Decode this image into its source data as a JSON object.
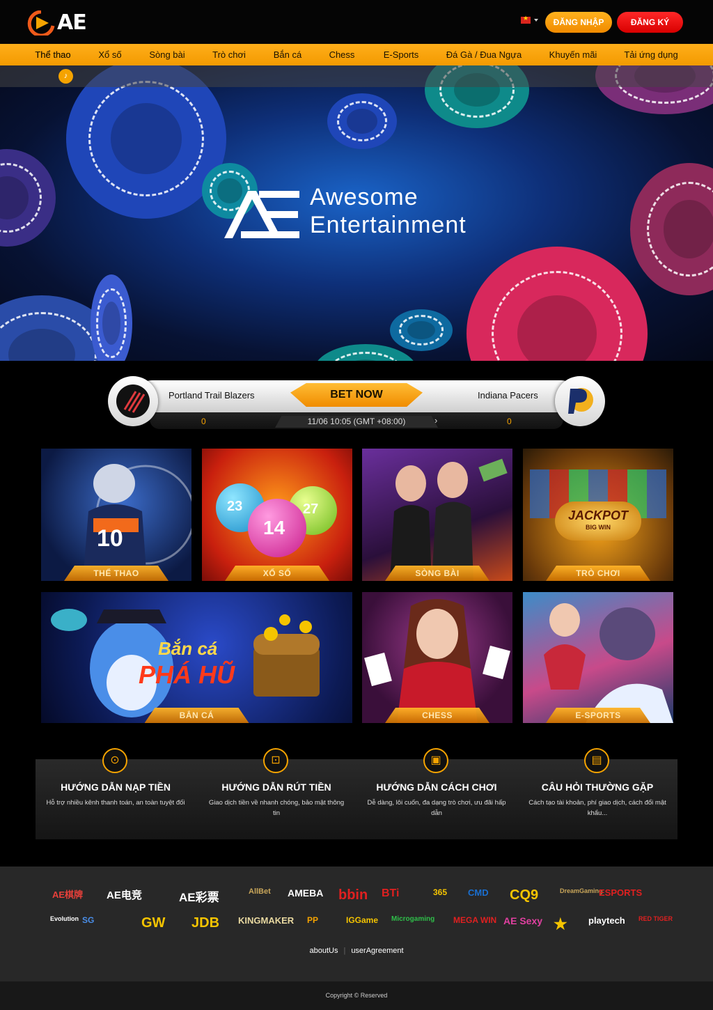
{
  "header": {
    "brand": "AE",
    "login_label": "ĐĂNG NHẬP",
    "register_label": "ĐĂNG KÝ"
  },
  "nav": {
    "items": [
      {
        "label": "Thể thao"
      },
      {
        "label": "Xổ số"
      },
      {
        "label": "Sòng bài"
      },
      {
        "label": "Trò chơi"
      },
      {
        "label": "Bắn cá"
      },
      {
        "label": "Chess"
      },
      {
        "label": "E-Sports"
      },
      {
        "label": "Đá Gà / Đua Ngựa"
      },
      {
        "label": "Khuyến mãi"
      },
      {
        "label": "Tải ứng dụng"
      }
    ]
  },
  "banner": {
    "line1": "Awesome",
    "line2": "Entertainment"
  },
  "match": {
    "home_team": "Portland Trail Blazers",
    "away_team": "Indiana Pacers",
    "bet_label": "BET NOW",
    "home_score": "0",
    "away_score": "0",
    "time": "11/06 10:05 (GMT +08:00)"
  },
  "games": {
    "tiles": [
      {
        "label": "THỂ THAO",
        "accent": "#1d4fa0"
      },
      {
        "label": "XỔ SỐ",
        "accent": "#c92a12"
      },
      {
        "label": "SÒNG BÀI",
        "accent": "#7a2b8a"
      },
      {
        "label": "TRÒ CHƠI",
        "accent": "#b86d12"
      },
      {
        "label": "BẮN CÁ",
        "accent": "#14338c"
      },
      {
        "label": "CHESS",
        "accent": "#7a1a4a"
      },
      {
        "label": "E-SPORTS",
        "accent": "#3c8cc8"
      }
    ],
    "fish_title_line1": "Bắn cá",
    "fish_title_line2": "PHÁ HŨ",
    "lottery_balls": [
      "23",
      "14",
      "27"
    ],
    "jersey_number": "10",
    "jackpot_text": "JACKPOT",
    "jackpot_sub": "BIG WIN"
  },
  "guides": [
    {
      "title": "HƯỚNG DẪN NẠP TIỀN",
      "desc": "Hỗ trợ nhiều kênh thanh toán, an toàn tuyệt đối"
    },
    {
      "title": "HƯỚNG DẪN RÚT TIỀN",
      "desc": "Giao dịch tiền về nhanh chóng, bảo mật thông tin"
    },
    {
      "title": "HƯỚNG DẪN CÁCH CHƠI",
      "desc": "Dễ dàng, lôi cuốn, đa dạng trò chơi, ưu đãi hấp dẫn"
    },
    {
      "title": "CÂU HỎI THƯỜNG GẶP",
      "desc": "Cách tạo tài khoản, phí giao dịch, cách đổi mật khẩu..."
    }
  ],
  "partners": [
    {
      "name": "AE棋牌",
      "color": "#e8403a"
    },
    {
      "name": "AE电竞",
      "color": "#ffffff"
    },
    {
      "name": "AE彩票",
      "color": "#ffffff"
    },
    {
      "name": "AllBet",
      "color": "#c9a65a"
    },
    {
      "name": "AMEBA",
      "color": "#ffffff"
    },
    {
      "name": "bbin",
      "color": "#e02020"
    },
    {
      "name": "BTi",
      "color": "#e02020"
    },
    {
      "name": "365",
      "color": "#f5c400"
    },
    {
      "name": "CMD",
      "color": "#1a6fd0"
    },
    {
      "name": "CQ9",
      "color": "#f5c400"
    },
    {
      "name": "DreamGaming",
      "color": "#c9a65a"
    },
    {
      "name": "ESPORTS",
      "color": "#e02020"
    },
    {
      "name": "Evolution",
      "color": "#ffffff"
    },
    {
      "name": "SG",
      "color": "#4a8ee8"
    },
    {
      "name": "GW",
      "color": "#f5c400"
    },
    {
      "name": "JDB",
      "color": "#f5c400"
    },
    {
      "name": "KINGMAKER",
      "color": "#e8d8a0"
    },
    {
      "name": "PP",
      "color": "#f5a300"
    },
    {
      "name": "IGGame",
      "color": "#f5c400"
    },
    {
      "name": "Microgaming",
      "color": "#2fbf4a"
    },
    {
      "name": "MEGA WIN",
      "color": "#e02020"
    },
    {
      "name": "AE Sexy",
      "color": "#e040a0"
    },
    {
      "name": "★",
      "color": "#f5c400"
    },
    {
      "name": "playtech",
      "color": "#ffffff"
    },
    {
      "name": "RED TIGER",
      "color": "#e02020"
    }
  ],
  "footer": {
    "about": "aboutUs",
    "agreement": "userAgreement",
    "copyright": "Copyright © Reserved"
  }
}
